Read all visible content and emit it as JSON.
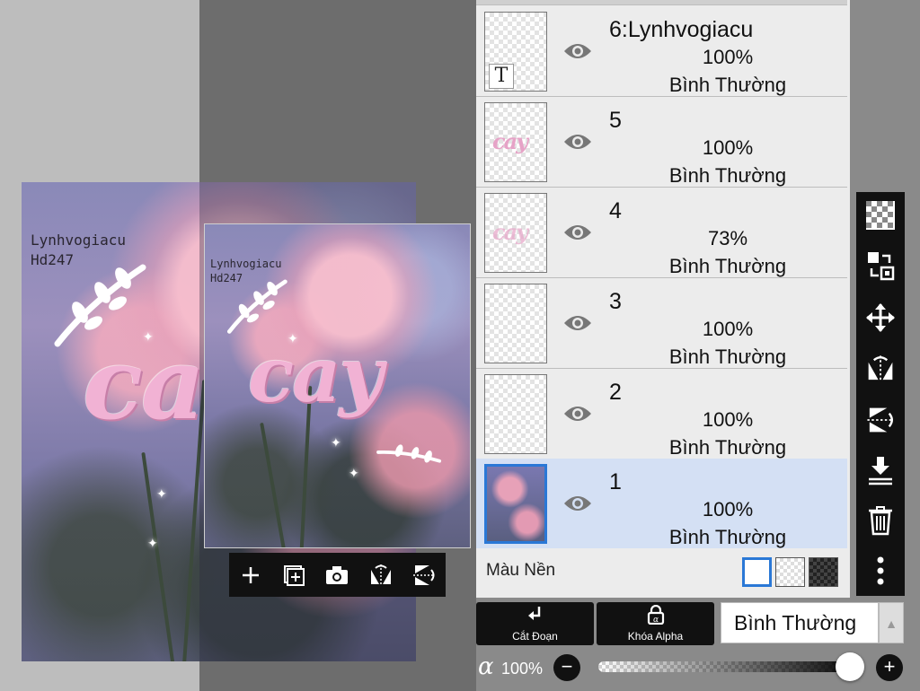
{
  "artwork": {
    "watermark_line1": "Lynhvogiacu",
    "watermark_line2": "Hd247",
    "sticker_text": "cay",
    "sticker_text_partial": "ca"
  },
  "layers": [
    {
      "name": "6:Lynhvogiacu",
      "opacity": "100%",
      "blend": "Bình Thường",
      "type": "text",
      "visible": true
    },
    {
      "name": "5",
      "opacity": "100%",
      "blend": "Bình Thường",
      "type": "sticker",
      "visible": true
    },
    {
      "name": "4",
      "opacity": "73%",
      "blend": "Bình Thường",
      "type": "sticker",
      "visible": true
    },
    {
      "name": "3",
      "opacity": "100%",
      "blend": "Bình Thường",
      "type": "empty",
      "visible": true
    },
    {
      "name": "2",
      "opacity": "100%",
      "blend": "Bình Thường",
      "type": "empty",
      "visible": true
    },
    {
      "name": "1",
      "opacity": "100%",
      "blend": "Bình Thường",
      "type": "photo",
      "visible": true,
      "selected": true
    }
  ],
  "background_row": {
    "label": "Màu Nền"
  },
  "bottom_bar": {
    "cut_label": "Cắt Đoạn",
    "alpha_lock_label": "Khóa Alpha",
    "blend_mode": "Bình Thường",
    "alpha_symbol": "α",
    "opacity_value": "100%",
    "opacity_level": 1.0
  },
  "colors": {
    "selection_blue": "#2a78d6",
    "selected_row": "#d4e0f4",
    "toolbar_black": "#111111"
  },
  "icons": {
    "floating_toolbar": [
      "plus-icon",
      "add-layer-icon",
      "camera-icon",
      "flip-horizontal-icon",
      "flip-vertical-icon"
    ],
    "tool_column": [
      "transparency-icon",
      "replace-layer-icon",
      "move-icon",
      "flip-horizontal-icon",
      "flip-vertical-icon",
      "merge-down-icon",
      "trash-icon",
      "more-icon"
    ]
  }
}
